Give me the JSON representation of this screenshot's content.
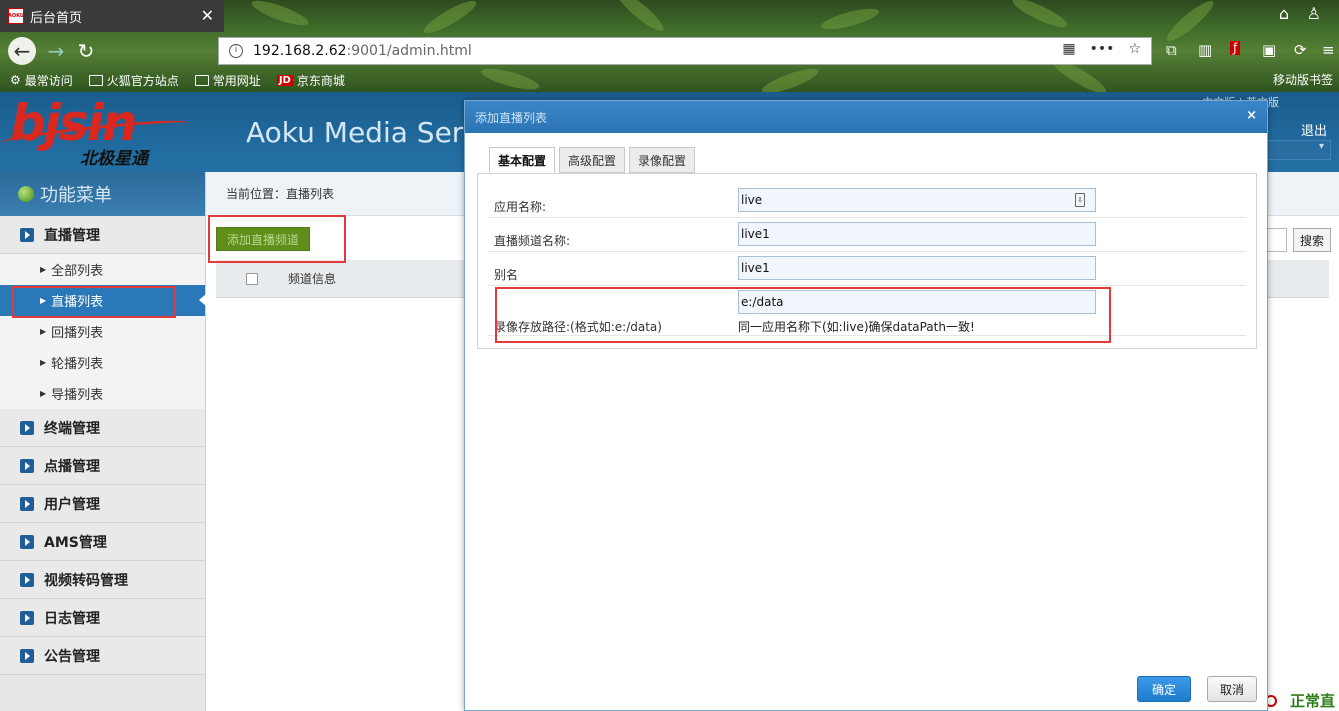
{
  "browser": {
    "tab_title": "后台首页",
    "favicon_text": "AOKU",
    "url_host": "192.168.2.62",
    "url_path": ":9001/admin.html",
    "bookmarks": [
      "最常访问",
      "火狐官方站点",
      "常用网址",
      "京东商城"
    ],
    "jd_badge": "JD",
    "mobile_bookmarks": "移动版书签"
  },
  "header": {
    "logo_text": "bjsin",
    "logo_cn": "北极星通",
    "app_title": "Aoku Media Server",
    "lang_links": "中文版 | 英文版",
    "logout": "退出"
  },
  "sidebar": {
    "title": "功能菜单",
    "groups": [
      {
        "label": "直播管理",
        "items": [
          "全部列表",
          "直播列表",
          "回播列表",
          "轮播列表",
          "导播列表"
        ]
      },
      {
        "label": "终端管理"
      },
      {
        "label": "点播管理"
      },
      {
        "label": "用户管理"
      },
      {
        "label": "AMS管理"
      },
      {
        "label": "视频转码管理"
      },
      {
        "label": "日志管理"
      },
      {
        "label": "公告管理"
      }
    ],
    "active_item": "直播列表"
  },
  "main": {
    "breadcrumb": "当前位置：直播列表",
    "add_button": "添加直播频道",
    "table_header": "频道信息",
    "search_button": "搜索",
    "status_text": "正常直"
  },
  "modal": {
    "title": "添加直播列表",
    "close": "×",
    "tabs": [
      "基本配置",
      "高级配置",
      "录像配置"
    ],
    "fields": {
      "app_name_label": "应用名称:",
      "app_name_value": "live",
      "channel_name_label": "直播频道名称:",
      "channel_name_value": "live1",
      "alias_label": "别名",
      "alias_value": "live1",
      "record_path_label": "录像存放路径:(格式如:e:/data)",
      "record_path_value": "e:/data",
      "record_path_hint": "同一应用名称下(如:live)确保dataPath一致!"
    },
    "ok_button": "确定",
    "cancel_button": "取消"
  }
}
